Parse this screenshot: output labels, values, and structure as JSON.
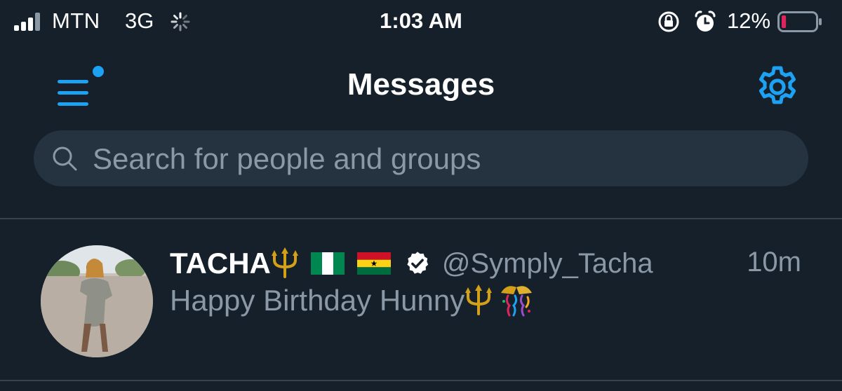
{
  "status_bar": {
    "carrier": "MTN",
    "network": "3G",
    "time": "1:03 AM",
    "battery_percent": "12%",
    "battery_level": 0.12,
    "icons": [
      "signal-icon",
      "loading-spinner-icon",
      "rotation-lock-icon",
      "alarm-icon",
      "battery-icon"
    ]
  },
  "header": {
    "title": "Messages",
    "menu_icon": "hamburger-menu-icon",
    "settings_icon": "gear-icon"
  },
  "search": {
    "placeholder": "Search for people and groups",
    "value": ""
  },
  "conversations": [
    {
      "name": "TACHA",
      "name_emojis": [
        "trident-emoji",
        "nigeria-flag",
        "ghana-flag"
      ],
      "verified": true,
      "handle": "@Symply_Tacha",
      "time_ago": "10m",
      "message": "Happy Birthday Hunny",
      "message_emojis": [
        "trident-emoji",
        "confetti-ball-emoji"
      ]
    }
  ],
  "colors": {
    "background": "#15202b",
    "accent": "#1da1f2",
    "secondary_text": "#8b98a5",
    "search_bg": "#253341",
    "divider": "#38444d",
    "battery_low": "#e0245e"
  }
}
